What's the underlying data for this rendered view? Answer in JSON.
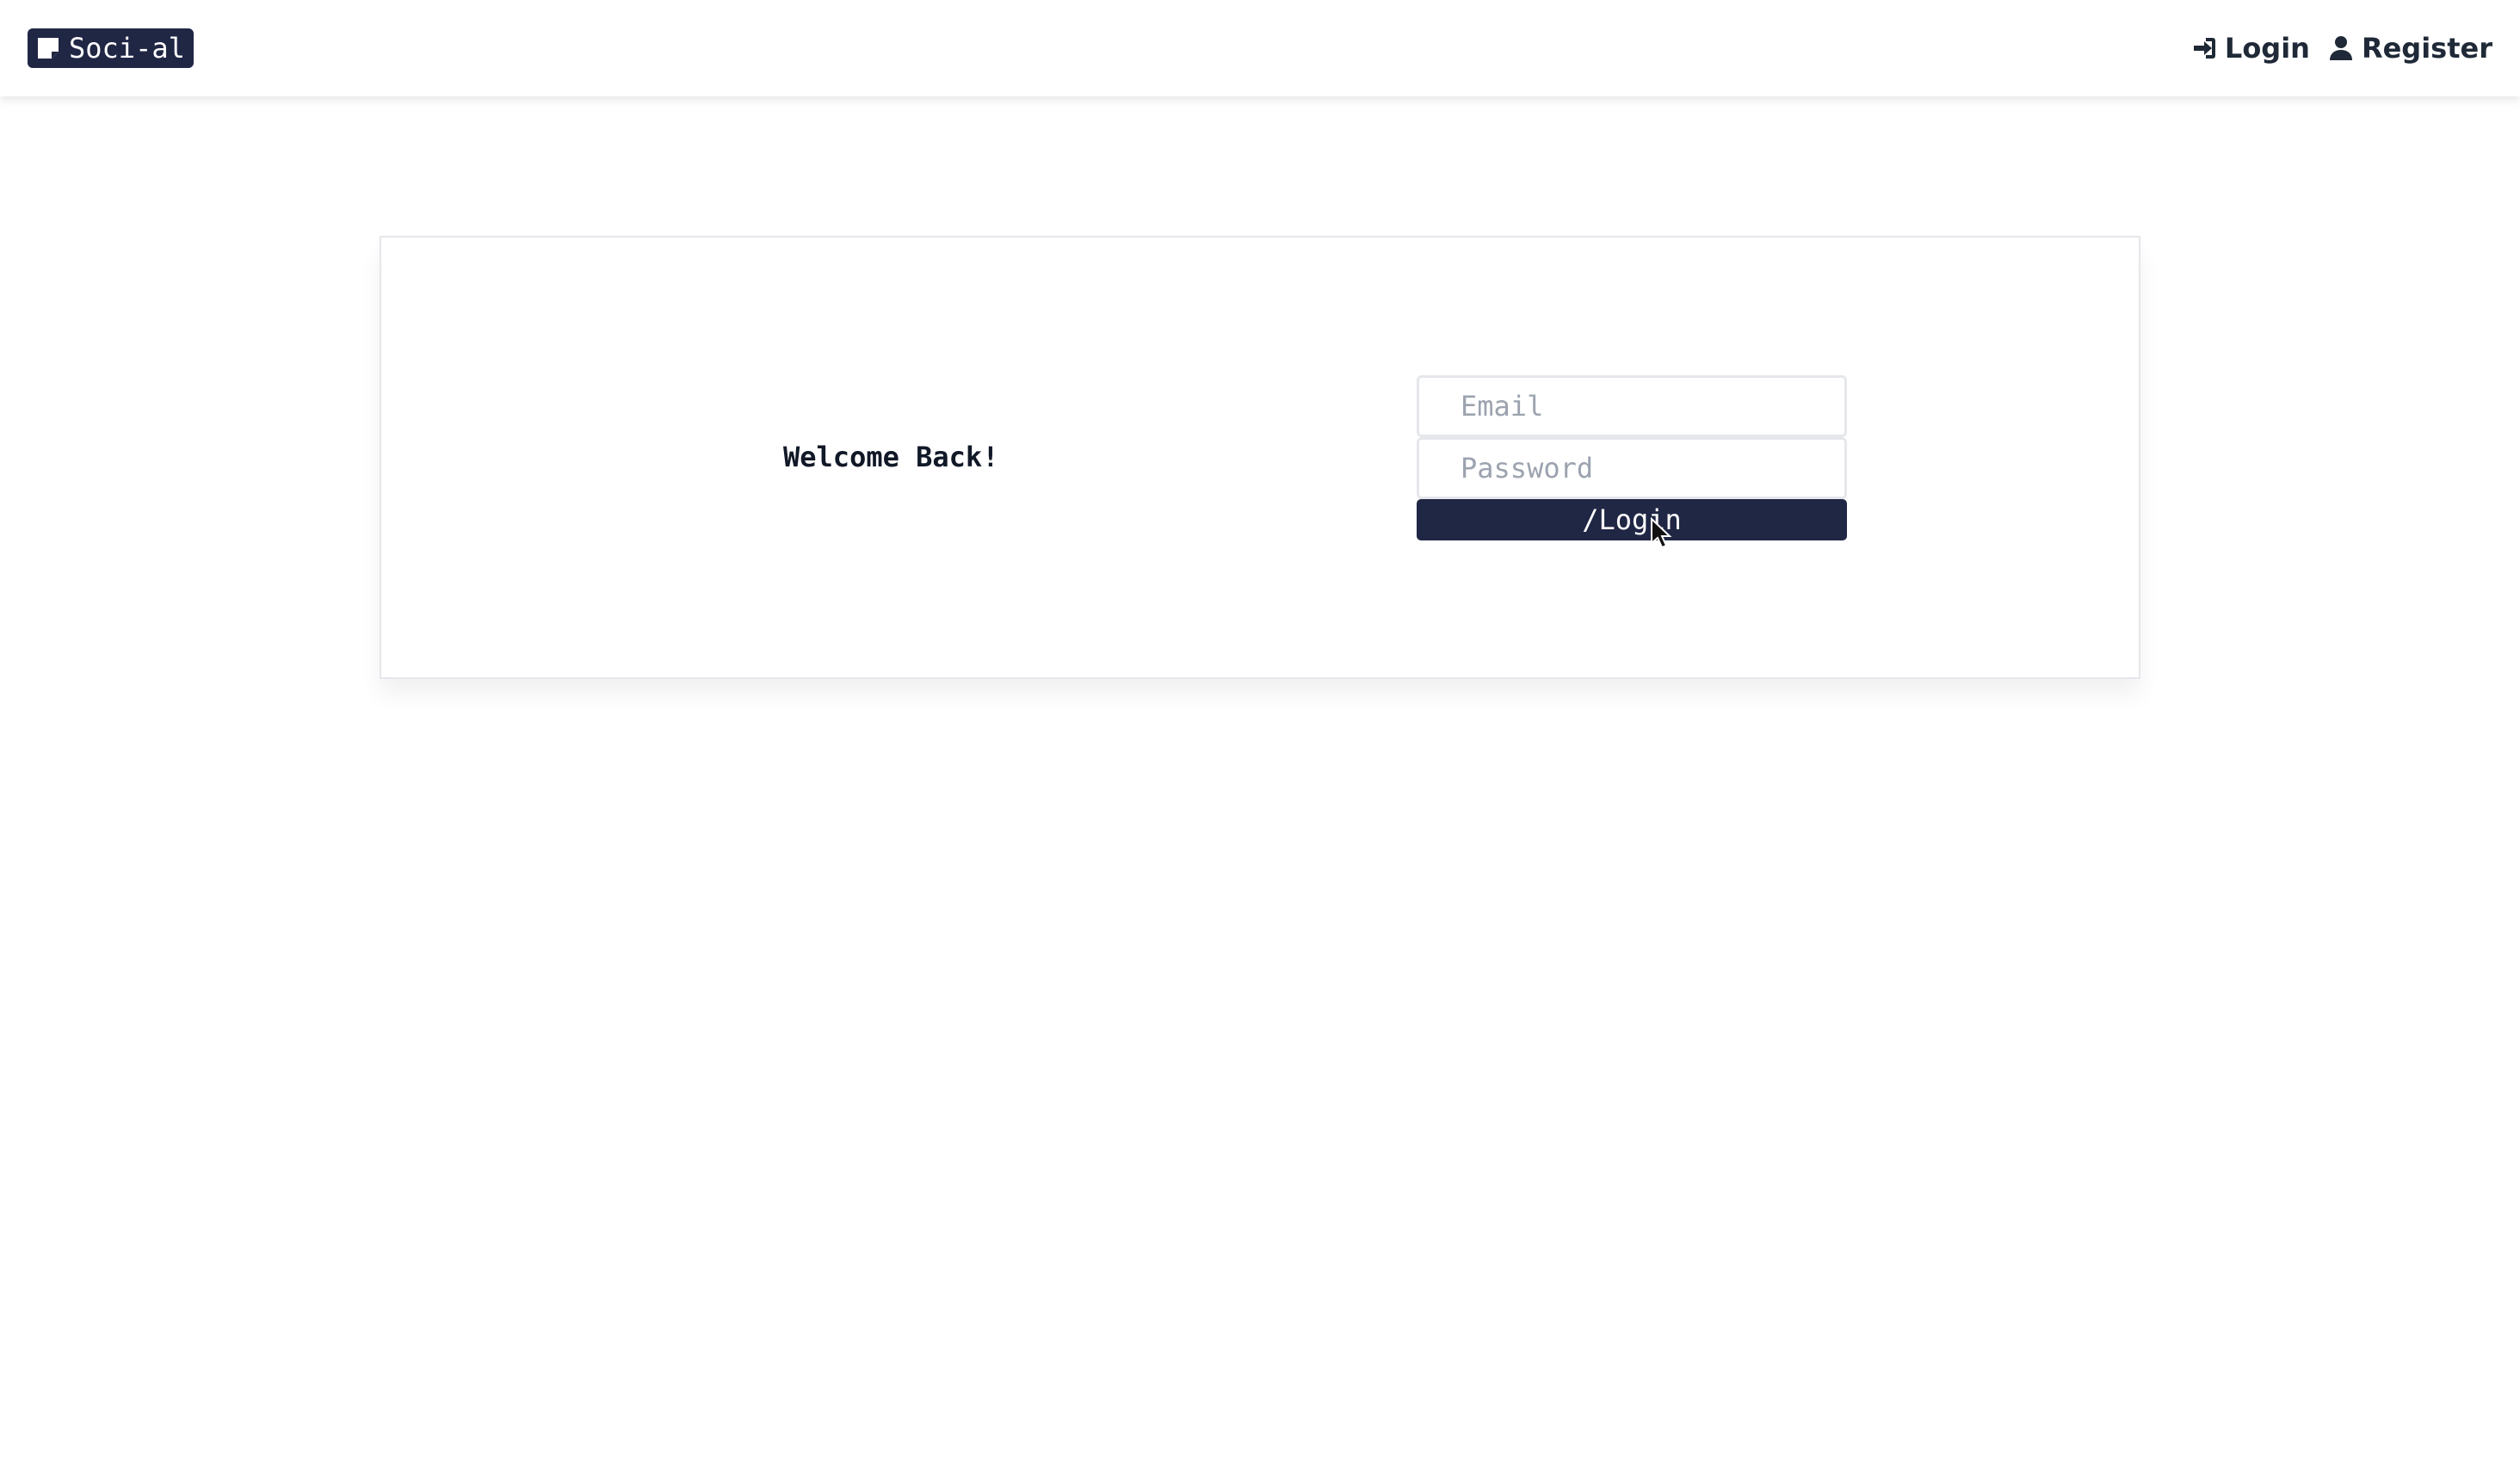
{
  "navbar": {
    "brand": {
      "icon": "note-icon",
      "label": "Soci-al"
    },
    "links": [
      {
        "icon": "sign-in-icon",
        "label": "Login"
      },
      {
        "icon": "user-icon",
        "label": "Register"
      }
    ]
  },
  "login_card": {
    "heading": "Welcome Back!",
    "email": {
      "placeholder": "Email",
      "value": ""
    },
    "password": {
      "placeholder": "Password",
      "value": ""
    },
    "submit_label": "/Login"
  },
  "colors": {
    "brand_dark": "#202745",
    "placeholder": "#9ca3af",
    "border": "#e5e7eb"
  }
}
